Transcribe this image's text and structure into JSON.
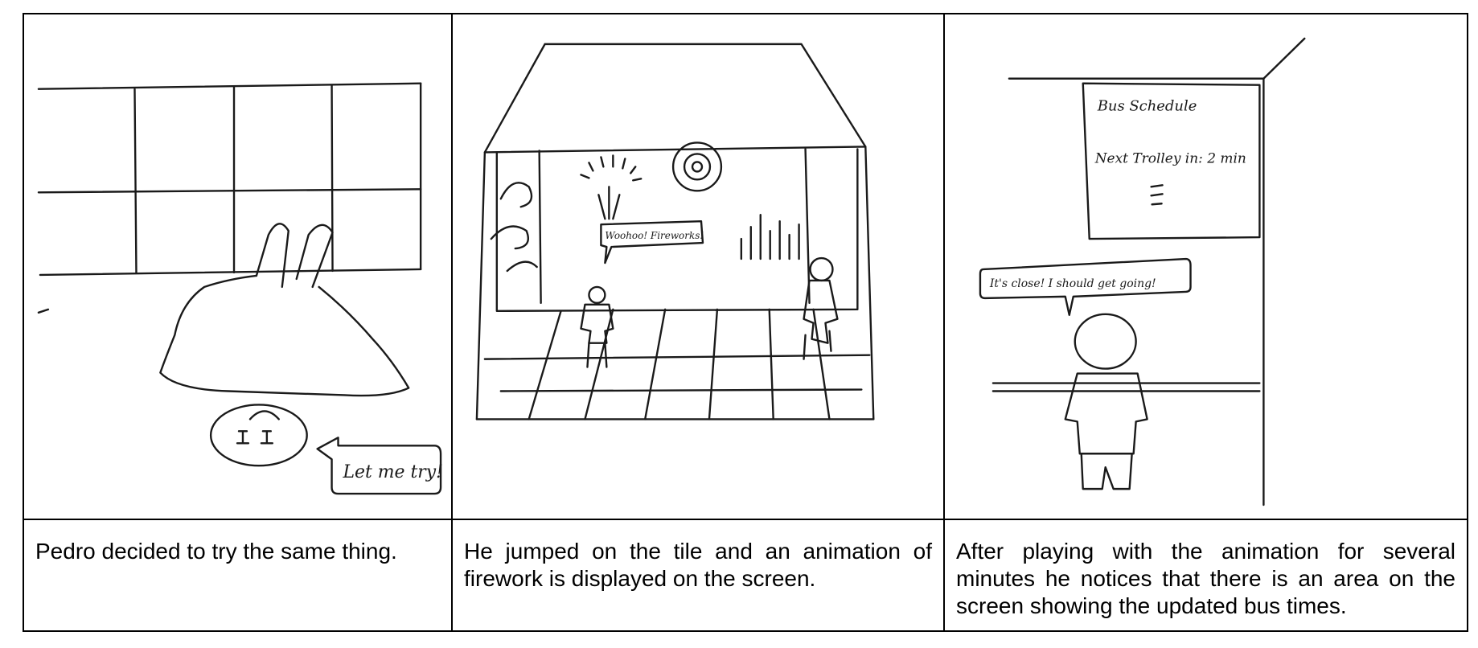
{
  "panels": [
    {
      "caption": "Pedro decided to try the same thing.",
      "speech": "Let me try!"
    },
    {
      "caption": "He jumped on the tile and an animation of firework is displayed on the screen.",
      "speech": "Woohoo! Fireworks!"
    },
    {
      "caption": "After playing with the animation for several minutes he notices that there is an area on the screen showing the updated bus times.",
      "speech": "It's close! I should get going!",
      "screen_title": "Bus Schedule",
      "screen_line": "Next Trolley in: 2 min"
    }
  ]
}
